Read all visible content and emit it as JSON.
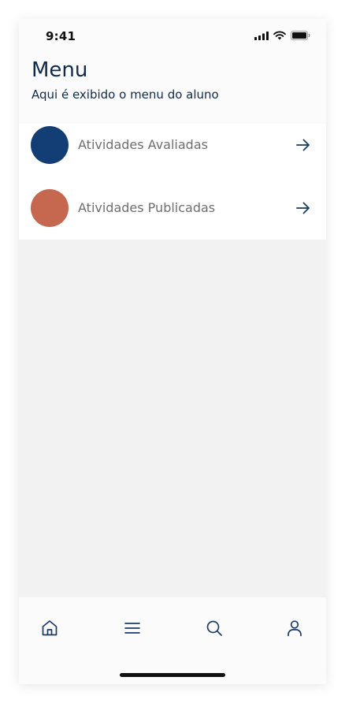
{
  "status_bar": {
    "time": "9:41",
    "icons": [
      "cellular-signal-icon",
      "wifi-icon",
      "battery-icon"
    ]
  },
  "header": {
    "title": "Menu",
    "subtitle": "Aqui é exibido o menu do aluno"
  },
  "menu": {
    "items": [
      {
        "label": "Atividades Avaliadas",
        "avatar_color": "#123d75",
        "icon": "arrow-right-icon"
      },
      {
        "label": "Atividades Publicadas",
        "avatar_color": "#c6674f",
        "icon": "arrow-right-icon"
      }
    ]
  },
  "bottom_nav": {
    "items": [
      {
        "icon": "home-icon"
      },
      {
        "icon": "menu-icon"
      },
      {
        "icon": "search-icon"
      },
      {
        "icon": "user-icon"
      }
    ]
  },
  "colors": {
    "primary": "#102a4c",
    "background": "#f2f2f2",
    "surface": "#ffffff",
    "nav_icon": "#1b3b68"
  }
}
